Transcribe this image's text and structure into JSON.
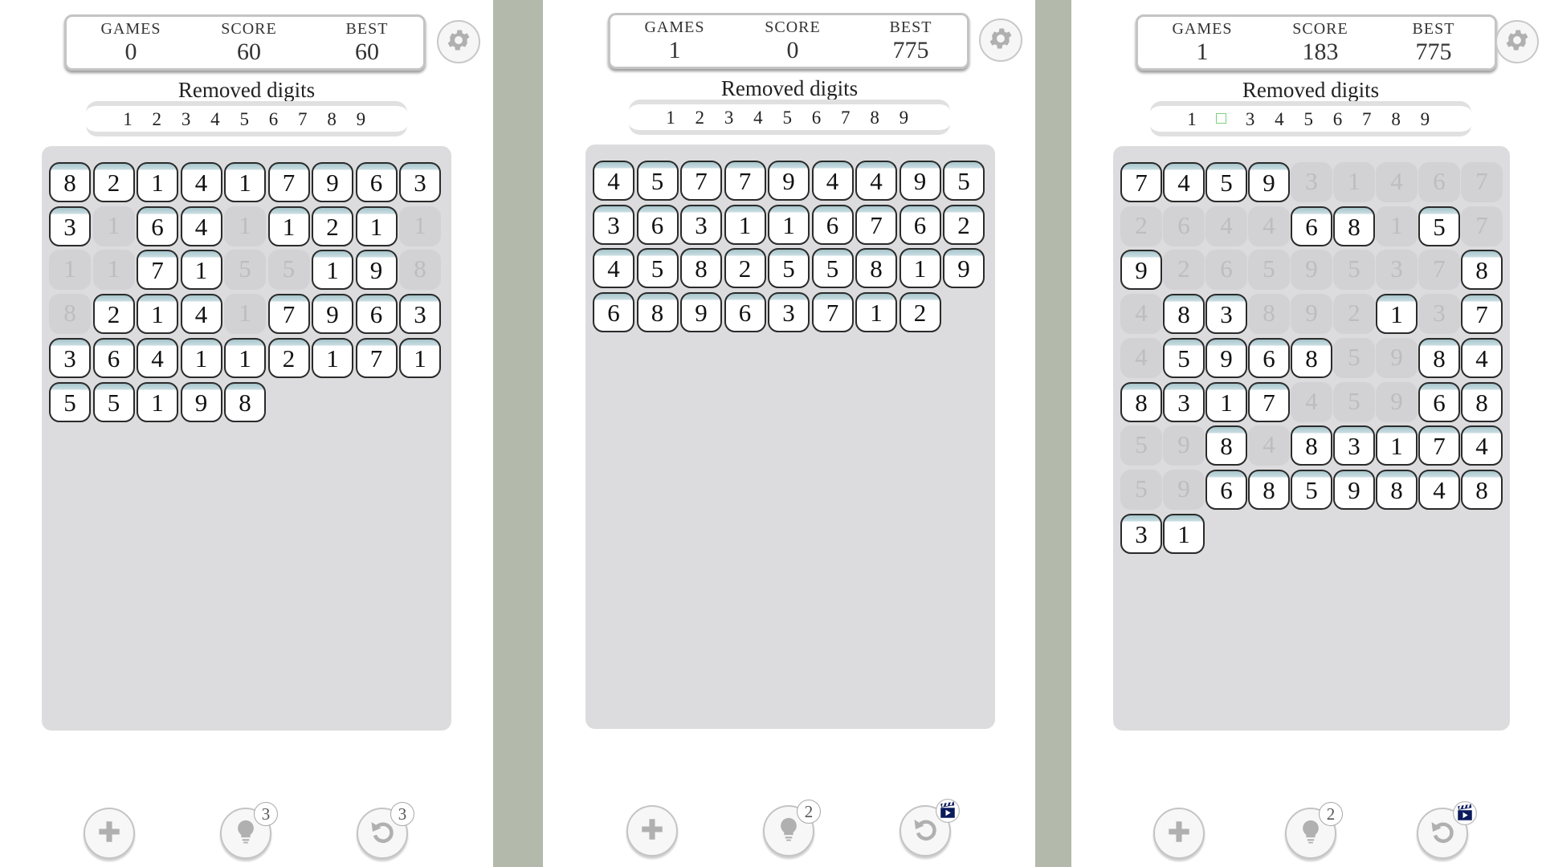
{
  "panels": [
    {
      "stats": {
        "games_label": "GAMES",
        "games": "0",
        "score_label": "SCORE",
        "score": "60",
        "best_label": "BEST",
        "best": "60"
      },
      "removed_title": "Removed digits",
      "removed_digits": [
        "1",
        "2",
        "3",
        "4",
        "5",
        "6",
        "7",
        "8",
        "9"
      ],
      "hint_count": "3",
      "undo_count": "3",
      "undo_badge": "count",
      "board": [
        [
          "8",
          "2",
          "1",
          "4",
          "1",
          "7",
          "9",
          "6",
          "3"
        ],
        [
          "3",
          "1x",
          "6",
          "4",
          "1x",
          "1",
          "2",
          "1",
          "1x"
        ],
        [
          "1x",
          "1x",
          "7",
          "1",
          "5x",
          "5x",
          "1",
          "9",
          "8x"
        ],
        [
          "8x",
          "2",
          "1",
          "4",
          "1x",
          "7",
          "9",
          "6",
          "3"
        ],
        [
          "3",
          "6",
          "4",
          "1",
          "1",
          "2",
          "1",
          "7",
          "1"
        ],
        [
          "5",
          "5",
          "1",
          "9",
          "8"
        ]
      ]
    },
    {
      "stats": {
        "games_label": "GAMES",
        "games": "1",
        "score_label": "SCORE",
        "score": "0",
        "best_label": "BEST",
        "best": "775"
      },
      "removed_title": "Removed digits",
      "removed_digits": [
        "1",
        "2",
        "3",
        "4",
        "5",
        "6",
        "7",
        "8",
        "9"
      ],
      "hint_count": "2",
      "undo_count": "",
      "undo_badge": "video",
      "board": [
        [
          "4",
          "5",
          "7",
          "7",
          "9",
          "4",
          "4",
          "9",
          "5"
        ],
        [
          "3",
          "6",
          "3",
          "1",
          "1",
          "6",
          "7",
          "6",
          "2"
        ],
        [
          "4",
          "5",
          "8",
          "2",
          "5",
          "5",
          "8",
          "1",
          "9"
        ],
        [
          "6",
          "8",
          "9",
          "6",
          "3",
          "7",
          "1",
          "2"
        ]
      ]
    },
    {
      "stats": {
        "games_label": "GAMES",
        "games": "1",
        "score_label": "SCORE",
        "score": "183",
        "best_label": "BEST",
        "best": "775"
      },
      "removed_title": "Removed digits",
      "removed_digits": [
        "1",
        "",
        "3",
        "4",
        "5",
        "6",
        "7",
        "8",
        "9"
      ],
      "hint_count": "2",
      "undo_count": "",
      "undo_badge": "video",
      "board": [
        [
          "7",
          "4",
          "5",
          "9",
          "3x",
          "1x",
          "4x",
          "6x",
          "7x"
        ],
        [
          "2x",
          "6x",
          "4x",
          "4x",
          "6",
          "8",
          "1x",
          "5",
          "7x"
        ],
        [
          "9",
          "2x",
          "6x",
          "5x",
          "9x",
          "5x",
          "3x",
          "7x",
          "8"
        ],
        [
          "4x",
          "8",
          "3",
          "8x",
          "9x",
          "2x",
          "1",
          "3x",
          "7"
        ],
        [
          "4x",
          "5",
          "9",
          "6",
          "8",
          "5x",
          "9x",
          "8",
          "4"
        ],
        [
          "8",
          "3",
          "1",
          "7",
          "4x",
          "5x",
          "9x",
          "6",
          "8"
        ],
        [
          "5x",
          "9x",
          "8",
          "4x",
          "8",
          "3",
          "1",
          "7",
          "4"
        ],
        [
          "5x",
          "9x",
          "6",
          "8",
          "5",
          "9",
          "8",
          "4",
          "8"
        ],
        [
          "3",
          "1"
        ]
      ]
    }
  ]
}
